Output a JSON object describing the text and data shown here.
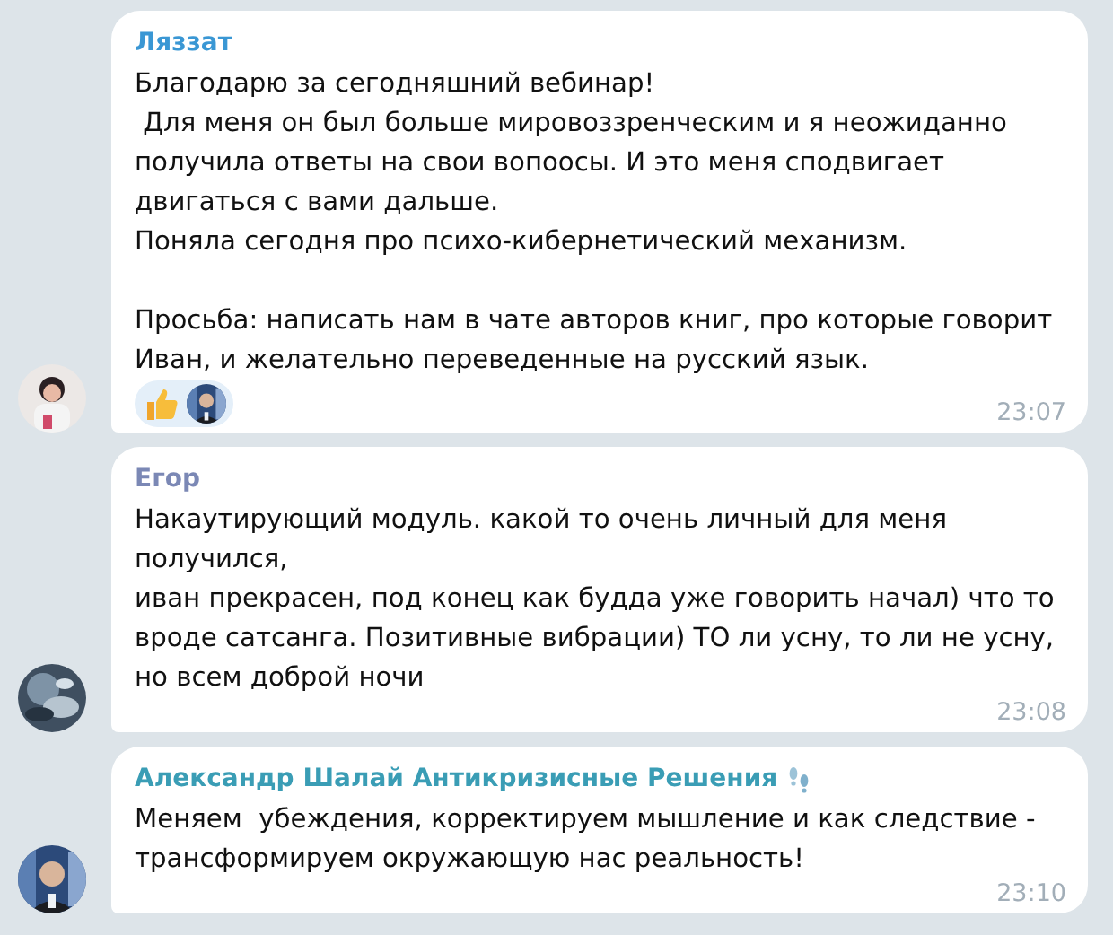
{
  "messages": [
    {
      "sender": "Ляззат",
      "color": "#3a97d4",
      "badge": false,
      "text": "Благодарю за сегодняшний вебинар!\n Для меня он был больше мировоззренческим и я неожиданно получила ответы на свои вопоосы. И это меня сподвигает двигаться с вами дальше.\nПоняла сегодня про психо-кибернетический механизм.\n\nПросьба: написать нам в чате авторов книг, про которые говорит Иван, и желательно переведенные на русский язык.",
      "reactions": [
        {
          "kind": "thumbs-up"
        }
      ],
      "time": "23:07"
    },
    {
      "sender": "Егор",
      "color": "#7b88b5",
      "badge": false,
      "text": "Накаутирующий модуль. какой то очень личный для меня получился,\nиван прекрасен, под конец как будда уже говорить начал) что то вроде сатсанга. Позитивные вибрации) ТО ли усну, то ли не усну, но всем доброй ночи",
      "time": "23:08"
    },
    {
      "sender": "Александр Шалай Антикризисные Решения",
      "color": "#3a9db5",
      "badge": true,
      "text": "Меняем  убеждения, корректируем мышление и как следствие - трансформируем окружающую нас реальность!",
      "time": "23:10"
    }
  ]
}
